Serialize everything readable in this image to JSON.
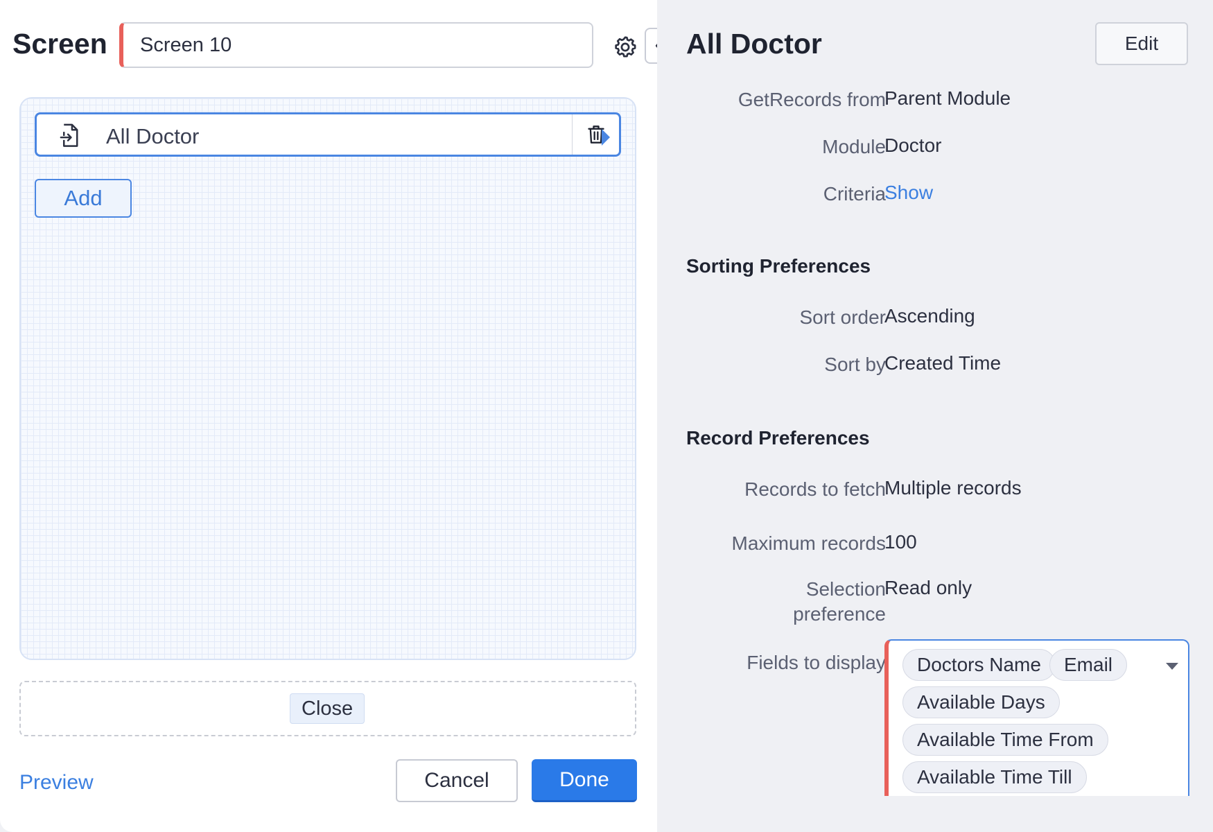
{
  "header": {
    "title": "Screen",
    "screen_name_value": "Screen 10"
  },
  "canvas": {
    "component": {
      "label": "All Doctor",
      "icon": "document-import-icon"
    },
    "add_label": "Add"
  },
  "footer": {
    "close_label": "Close",
    "preview_label": "Preview",
    "cancel_label": "Cancel",
    "done_label": "Done"
  },
  "colors": {
    "accent": "#2a7ae8",
    "required_marker": "#e8605a",
    "link": "#3b7fe0"
  },
  "properties": {
    "title": "All Doctor",
    "edit_label": "Edit",
    "source": {
      "getrecords_label": "GetRecords from",
      "getrecords_value": "Parent Module",
      "module_label": "Module",
      "module_value": "Doctor",
      "criteria_label": "Criteria",
      "criteria_value": "Show"
    },
    "sorting": {
      "title": "Sorting Preferences",
      "order_label": "Sort order",
      "order_value": "Ascending",
      "by_label": "Sort by",
      "by_value": "Created Time"
    },
    "records": {
      "title": "Record Preferences",
      "fetch_label": "Records to fetch",
      "fetch_value": "Multiple records",
      "max_label": "Maximum records",
      "max_value": "100",
      "selection_label_1": "Selection",
      "selection_label_2": "preference",
      "selection_value": "Read only",
      "fields_label": "Fields to display",
      "fields": [
        "Doctors Name",
        "Email",
        "Available Days",
        "Available Time From",
        "Available Time Till"
      ]
    }
  }
}
